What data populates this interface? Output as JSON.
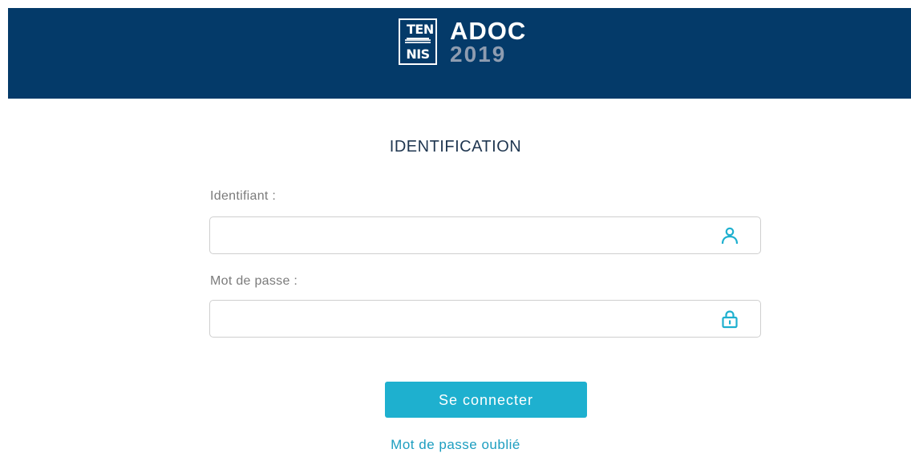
{
  "header": {
    "logo": {
      "top_text": "TEN",
      "bottom_text": "NIS"
    },
    "brand_name": "ADOC",
    "brand_year": "2019"
  },
  "form": {
    "title": "IDENTIFICATION",
    "username": {
      "label": "Identifiant :",
      "value": "",
      "icon": "user-icon"
    },
    "password": {
      "label": "Mot de passe :",
      "value": "",
      "icon": "lock-icon"
    },
    "submit_label": "Se connecter",
    "forgot_label": "Mot de passe oublié"
  },
  "colors": {
    "header_bg": "#043a69",
    "accent": "#1eb0cf",
    "link": "#1d9ec0",
    "title": "#1f3650"
  }
}
